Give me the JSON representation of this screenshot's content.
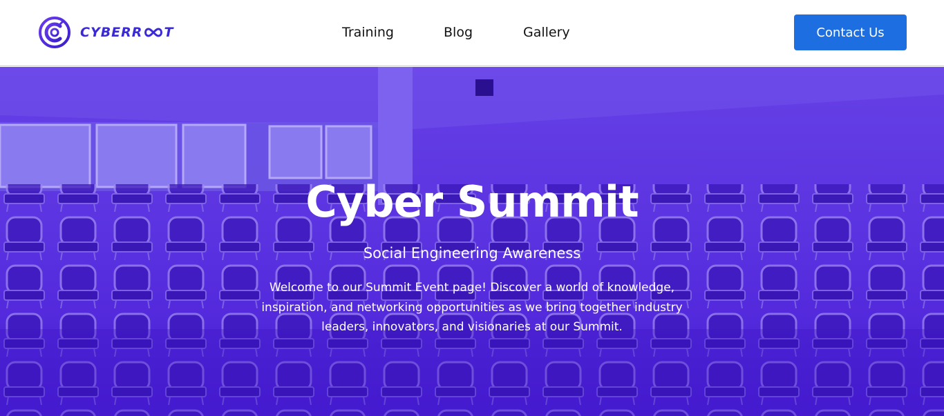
{
  "brand": {
    "name": "CYBERR",
    "name_suffix": "T",
    "logo_icon": "cyberroot-c-logo-icon",
    "colors": {
      "primary": "#3a2ad6",
      "accent": "#7b3cf0"
    }
  },
  "nav": {
    "items": [
      {
        "label": "Training"
      },
      {
        "label": "Blog"
      },
      {
        "label": "Gallery"
      }
    ],
    "contact_label": "Contact Us",
    "contact_color": "#1d6ee0"
  },
  "hero": {
    "title": "Cyber Summit",
    "subtitle": "Social Engineering Awareness",
    "description": "Welcome to our Summit Event page! Discover a world of knowledge, inspiration, and networking opportunities as we bring together industry leaders, innovators, and visionaries at our Summit.",
    "overlay_color": "#4f22d8",
    "background_image": "conference-room-chairs"
  }
}
